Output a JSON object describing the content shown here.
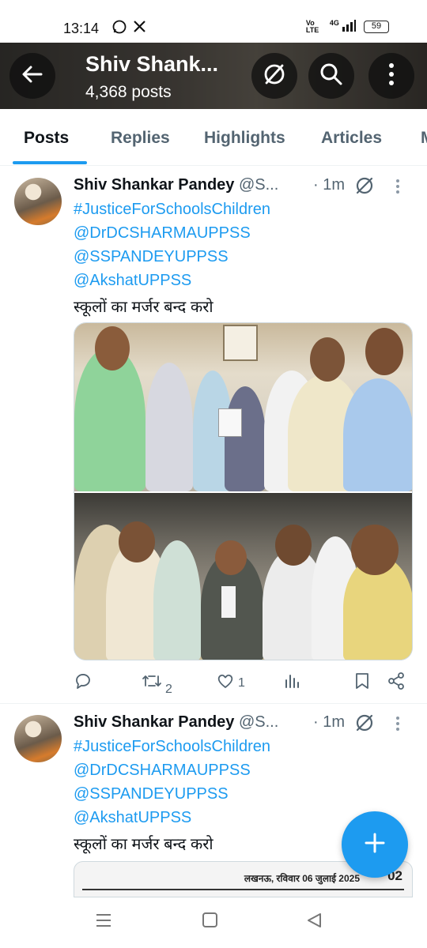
{
  "status_bar": {
    "time": "13:14",
    "battery": "59",
    "network": "4G",
    "volte": "Vo LTE"
  },
  "profile_header": {
    "name": "Shiv Shank...",
    "posts_count": "4,368 posts"
  },
  "tabs": [
    {
      "label": "Posts"
    },
    {
      "label": "Replies"
    },
    {
      "label": "Highlights"
    },
    {
      "label": "Articles"
    }
  ],
  "posts": [
    {
      "display_name": "Shiv Shankar Pandey",
      "handle": "@S...",
      "time": "· 1m",
      "lines": [
        {
          "text": "#JusticeForSchoolsChildren",
          "kind": "link"
        },
        {
          "text": "@DrDCSHARMAUPPSS",
          "kind": "link"
        },
        {
          "text": "@SSPANDEYUPPSS",
          "kind": "link"
        },
        {
          "text": "@AkshatUPPSS",
          "kind": "link"
        },
        {
          "text": "स्कूलों का मर्जर बन्द करो",
          "kind": "text"
        }
      ],
      "stats": {
        "replies": "",
        "reposts": "2",
        "likes": "1"
      }
    },
    {
      "display_name": "Shiv Shankar Pandey",
      "handle": "@S...",
      "time": "· 1m",
      "lines": [
        {
          "text": "#JusticeForSchoolsChildren",
          "kind": "link"
        },
        {
          "text": "@DrDCSHARMAUPPSS",
          "kind": "link"
        },
        {
          "text": "@SSPANDEYUPPSS",
          "kind": "link"
        },
        {
          "text": "@AkshatUPPSS",
          "kind": "link"
        },
        {
          "text": "स्कूलों का मर्जर बन्द करो",
          "kind": "text"
        }
      ],
      "newspaper_header": "लखनऊ, रविवार 06 जुलाई 2025",
      "newspaper_page": "02"
    }
  ],
  "colors": {
    "accent": "#1d9bf0",
    "text": "#0f1419",
    "muted": "#536471"
  }
}
